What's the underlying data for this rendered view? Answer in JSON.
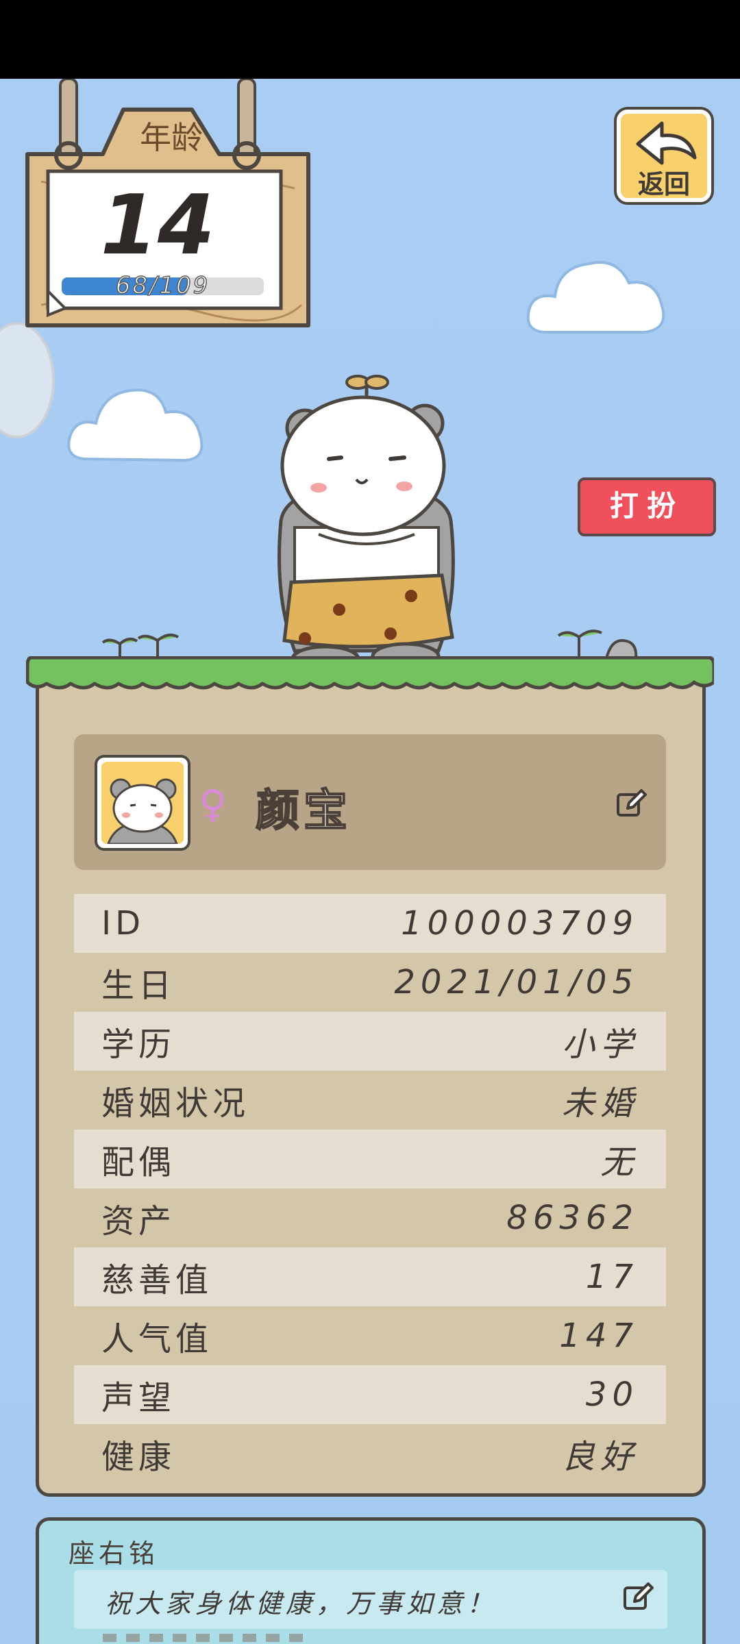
{
  "age_sign": {
    "title": "年龄",
    "age": "14",
    "progress_text": "68/109",
    "progress_fraction": 0.624
  },
  "back_button": {
    "label": "返回",
    "icon": "back-arrow-icon"
  },
  "dress_button": {
    "label": "打扮"
  },
  "profile": {
    "gender_symbol": "♀",
    "name": "颜宝",
    "edit_icon": "edit-icon"
  },
  "info": [
    {
      "label": "ID",
      "value": "100003709"
    },
    {
      "label": "生日",
      "value": "2021/01/05"
    },
    {
      "label": "学历",
      "value": "小学"
    },
    {
      "label": "婚姻状况",
      "value": "未婚"
    },
    {
      "label": "配偶",
      "value": "无"
    },
    {
      "label": "资产",
      "value": "86362"
    },
    {
      "label": "慈善值",
      "value": "17"
    },
    {
      "label": "人气值",
      "value": "147"
    },
    {
      "label": "声望",
      "value": "30"
    },
    {
      "label": "健康",
      "value": "良好"
    }
  ],
  "motto": {
    "label": "座右铭",
    "text": "祝大家身体健康，万事如意！",
    "edit_icon": "edit-icon"
  },
  "colors": {
    "sky": "#a9cdf2",
    "card": "#d4c6a9",
    "accent_red": "#f0505c",
    "accent_yellow": "#f8d06c",
    "progress_blue": "#3f86d2",
    "motto_bg": "#a9dde7"
  }
}
